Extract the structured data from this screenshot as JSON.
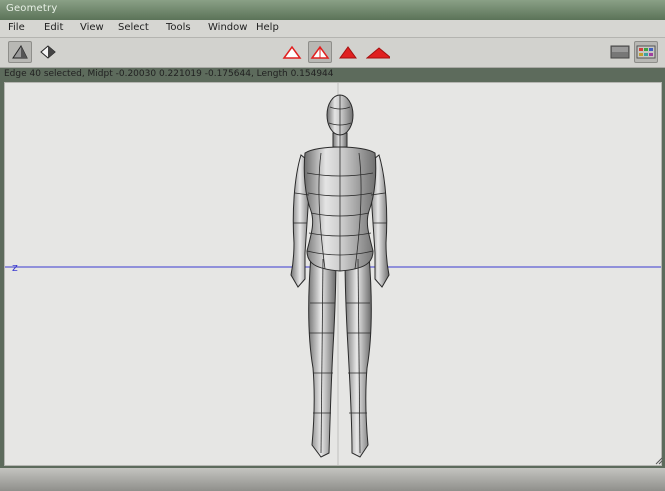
{
  "window": {
    "title": "Geometry"
  },
  "menu": [
    "File",
    "Edit",
    "View",
    "Select",
    "Tools",
    "Window",
    "Help"
  ],
  "toolbar": {
    "left_icons": [
      "shaded-triangle-icon",
      "shaded-diamond-icon"
    ],
    "center_icons": [
      "white-triangle-icon",
      "white-triangle-selected-icon",
      "red-triangle-icon",
      "red-wide-triangle-icon"
    ],
    "right_icons": [
      "gray-panel-icon",
      "color-grid-icon"
    ]
  },
  "status": {
    "text": "Edge 40 selected, Midpt -0.20030 0.221019 -0.175644, Length 0.154944"
  },
  "viewport": {
    "axis_label": "z",
    "axis_color": "#3a3ad0",
    "background": "#e6e6e4"
  },
  "colors": {
    "accent_red": "#e02020",
    "titlebar": "#6f876c"
  }
}
